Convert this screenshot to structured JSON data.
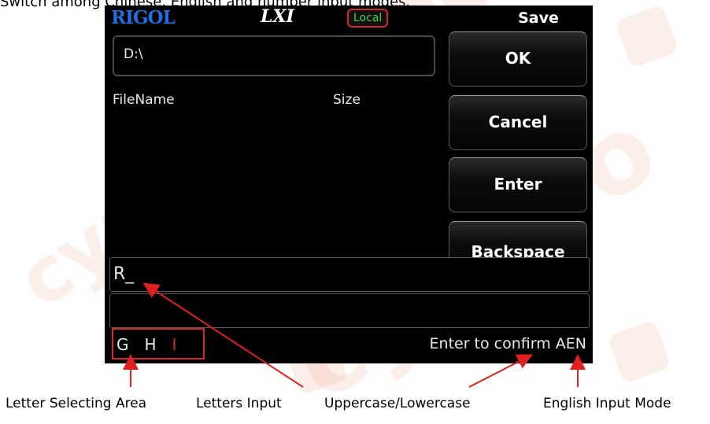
{
  "caption": "Switch among Chinese, English and number input modes.",
  "header": {
    "brand": "RIGOL",
    "lxi": "LXI",
    "status": "Local",
    "menu_title": "Save"
  },
  "file_browser": {
    "path": "D:\\",
    "columns": [
      "FileName",
      "Size"
    ]
  },
  "softkeys": [
    "OK",
    "Cancel",
    "Enter",
    "Backspace"
  ],
  "input": {
    "text": "R_"
  },
  "letter_area": {
    "letters": [
      "G",
      "H",
      "I"
    ],
    "selected": "I"
  },
  "status_bar": {
    "hint": "Enter to confirm",
    "case": "A",
    "mode": "EN"
  },
  "annotations": [
    "Letter Selecting Area",
    "Letters Input",
    "Uppercase/Lowercase",
    "English Input Mode"
  ],
  "watermark": "cynepo",
  "colors": {
    "brand": "#1f6fe0",
    "local_border": "#d62828",
    "local_text": "#3fd24a",
    "highlight": "#d62828"
  }
}
